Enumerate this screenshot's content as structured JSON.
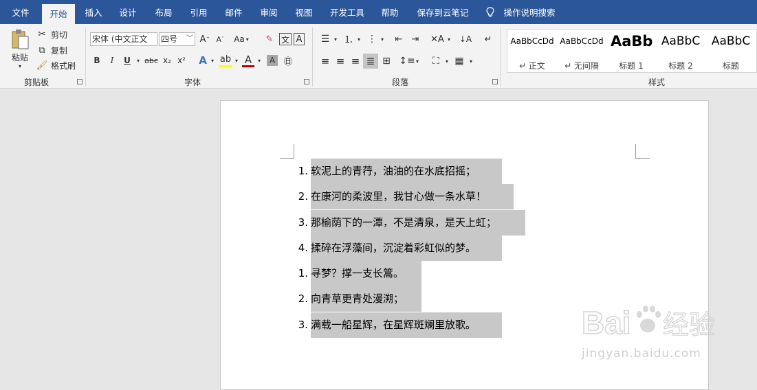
{
  "tabs": [
    {
      "label": "文件",
      "active": false
    },
    {
      "label": "开始",
      "active": true
    },
    {
      "label": "插入",
      "active": false
    },
    {
      "label": "设计",
      "active": false
    },
    {
      "label": "布局",
      "active": false
    },
    {
      "label": "引用",
      "active": false
    },
    {
      "label": "邮件",
      "active": false
    },
    {
      "label": "审阅",
      "active": false
    },
    {
      "label": "视图",
      "active": false
    },
    {
      "label": "开发工具",
      "active": false
    },
    {
      "label": "帮助",
      "active": false
    },
    {
      "label": "保存到云笔记",
      "active": false
    }
  ],
  "tell_me": "操作说明搜索",
  "clipboard": {
    "paste": "粘贴",
    "cut": "剪切",
    "copy": "复制",
    "format_painter": "格式刷",
    "group": "剪贴板"
  },
  "font": {
    "name": "宋体 (中文正文",
    "size": "四号",
    "group": "字体",
    "bold": "B",
    "italic": "I",
    "underline": "U",
    "strike": "abc",
    "sub": "x₂",
    "sup": "x²",
    "case": "Aa",
    "grow": "A",
    "shrink": "A",
    "clear": "A"
  },
  "paragraph": {
    "group": "段落"
  },
  "styles": {
    "group": "样式",
    "items": [
      {
        "sample": "AaBbCcDd",
        "name": "↵ 正文"
      },
      {
        "sample": "AaBbCcDd",
        "name": "↵ 无间隔"
      },
      {
        "sample": "AaBb",
        "name": "标题 1"
      },
      {
        "sample": "AaBbC",
        "name": "标题 2"
      },
      {
        "sample": "AaBbC",
        "name": "标题"
      }
    ]
  },
  "document": {
    "lines": [
      {
        "num": "1.",
        "text": "软泥上的青荇，油油的在水底招摇；"
      },
      {
        "num": "2.",
        "text": "在康河的柔波里，我甘心做一条水草！"
      },
      {
        "num": "3.",
        "text": "那榆荫下的一潭，不是清泉，是天上虹；"
      },
      {
        "num": "4.",
        "text": "揉碎在浮藻间，沉淀着彩虹似的梦。"
      },
      {
        "num": "1.",
        "text": "寻梦？撑一支长篙。"
      },
      {
        "num": "2.",
        "text": "向青草更青处漫溯；"
      },
      {
        "num": "3.",
        "text": "满载一船星辉，在星辉斑斓里放歌。"
      }
    ]
  },
  "watermark": {
    "brand": "Bai",
    "brand2": "经验",
    "url": "jingyan.baidu.com"
  },
  "colors": {
    "accent": "#2b579a",
    "highlight": "#c8c8c8",
    "font_red": "#c00000"
  }
}
